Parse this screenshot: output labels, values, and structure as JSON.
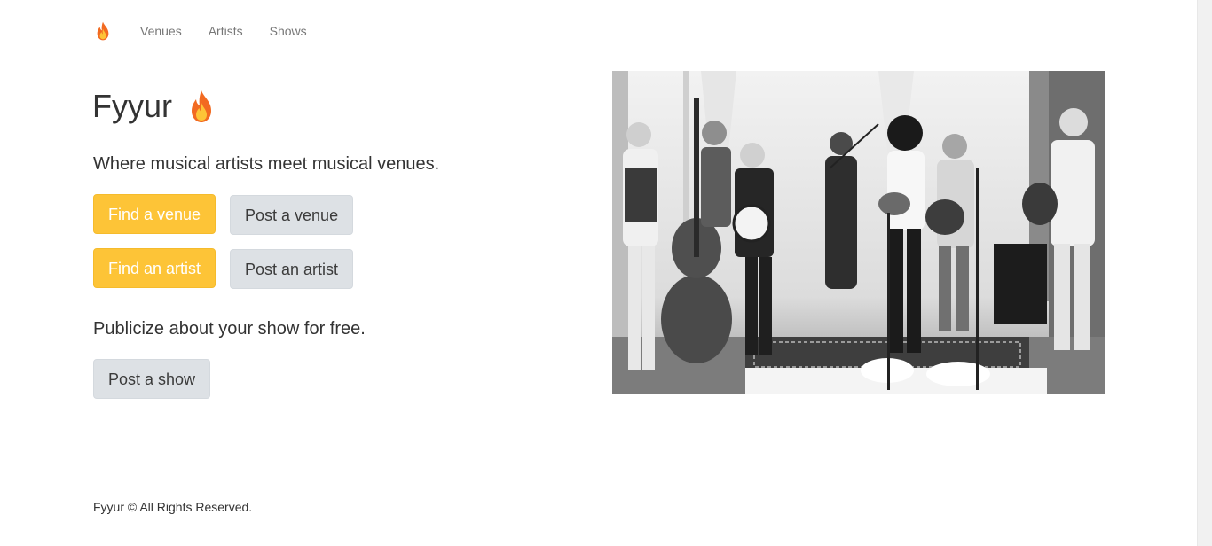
{
  "nav": {
    "brand_icon": "flame-icon",
    "items": [
      "Venues",
      "Artists",
      "Shows"
    ]
  },
  "hero": {
    "title": "Fyyur",
    "title_icon": "flame-icon",
    "tagline": "Where musical artists meet musical venues.",
    "publicize": "Publicize about your show for free."
  },
  "buttons": {
    "find_venue": "Find a venue",
    "post_venue": "Post a venue",
    "find_artist": "Find an artist",
    "post_artist": "Post an artist",
    "post_show": "Post a show"
  },
  "image": {
    "subject": "black-and-white photo of a bluegrass band playing"
  },
  "footer": {
    "text": "Fyyur © All Rights Reserved."
  },
  "colors": {
    "primary_button": "#fdc437",
    "secondary_button": "#dde1e5",
    "flame_outer": "#f26a21",
    "flame_inner": "#fdc437"
  }
}
